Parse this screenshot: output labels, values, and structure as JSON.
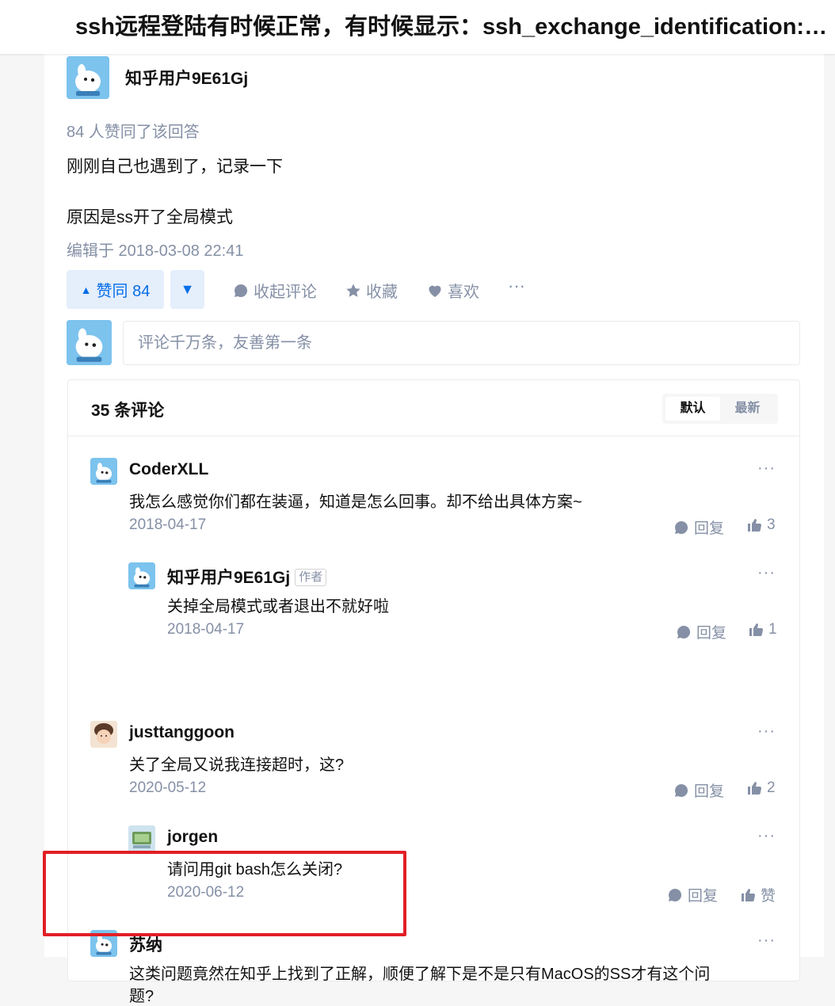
{
  "question_title": "ssh远程登陆有时候正常，有时候显示：ssh_exchange_identification: read: Connection reset by peer",
  "answer": {
    "author_name": "知乎用户9E61Gj",
    "vote_summary": "84 人赞同了该回答",
    "paragraphs": [
      "刚刚自己也遇到了，记录一下",
      "原因是ss开了全局模式"
    ],
    "edited": "编辑于 2018-03-08 22:41",
    "actions": {
      "upvote_label": "赞同 84",
      "collapse_comments": "收起评论",
      "favorite": "收藏",
      "like": "喜欢"
    }
  },
  "comment_input": {
    "placeholder": "评论千万条，友善第一条"
  },
  "comments": {
    "count_label": "35 条评论",
    "sort": {
      "default": "默认",
      "newest": "最新"
    },
    "items": [
      {
        "author": "CoderXLL",
        "text": "我怎么感觉你们都在装逼，知道是怎么回事。却不给出具体方案~",
        "date": "2018-04-17",
        "reply": "回复",
        "likes": "3"
      },
      {
        "author": "知乎用户9E61Gj",
        "badge": "作者",
        "text": "关掉全局模式或者退出不就好啦",
        "date": "2018-04-17",
        "reply": "回复",
        "likes": "1"
      },
      {
        "author": "justtanggoon",
        "text": "关了全局又说我连接超时，这?",
        "date": "2020-05-12",
        "reply": "回复",
        "likes": "2"
      },
      {
        "author": "jorgen",
        "text": "请问用git bash怎么关闭?",
        "date": "2020-06-12",
        "reply": "回复",
        "likes": "赞"
      },
      {
        "author": "苏纳",
        "text": "这类问题竟然在知乎上找到了正解，顺便了解下是不是只有MacOS的SS才有这个问",
        "text2": "题?"
      }
    ]
  },
  "colors": {
    "brand_blue": "#056de8",
    "gray_text": "#8590a6",
    "highlight_red": "#e21f26"
  },
  "icons": [
    "arrow-up-icon",
    "arrow-down-icon",
    "comment-icon",
    "star-icon",
    "heart-icon",
    "more-icon",
    "thumbs-up-icon"
  ]
}
